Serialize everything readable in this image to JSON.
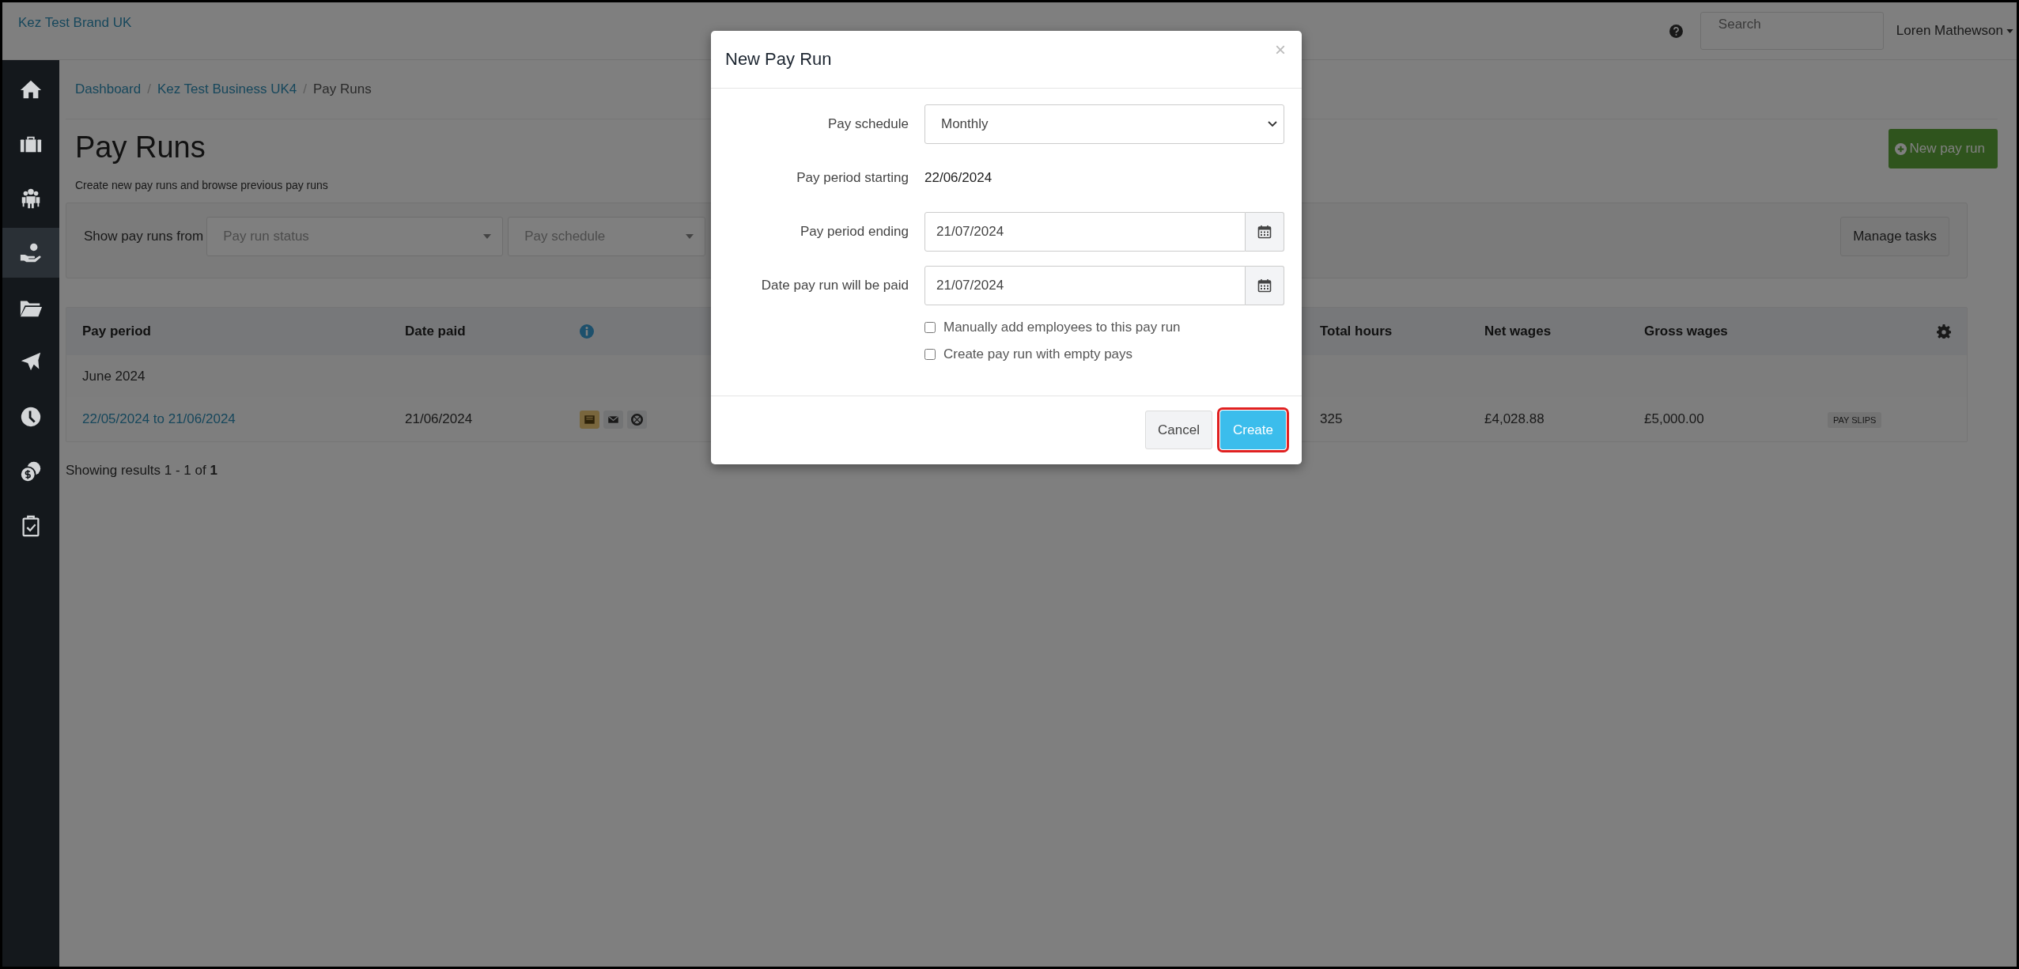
{
  "topbar": {
    "brand": "Kez Test Brand UK",
    "search": {
      "placeholder": "Search"
    },
    "user": "Loren Mathewson"
  },
  "sidebar": {
    "items": [
      {
        "kind": "home",
        "selected": false
      },
      {
        "kind": "briefcase",
        "selected": false
      },
      {
        "kind": "people",
        "selected": false
      },
      {
        "kind": "hand-coin",
        "selected": true
      },
      {
        "kind": "folder",
        "selected": false
      },
      {
        "kind": "plane",
        "selected": false
      },
      {
        "kind": "clock",
        "selected": false
      },
      {
        "kind": "coins",
        "selected": false
      },
      {
        "kind": "clipboard",
        "selected": false
      }
    ]
  },
  "breadcrumb": {
    "separator": "/",
    "items": [
      "Dashboard",
      "Kez Test Business UK4",
      "Pay Runs"
    ]
  },
  "page": {
    "title": "Pay Runs",
    "subtitle": "Create new pay runs and browse previous pay runs",
    "new_button": "New pay run"
  },
  "filters": {
    "label": "Show pay runs from",
    "selects": [
      {
        "placeholder": "Pay run status"
      },
      {
        "placeholder": "Pay schedule"
      }
    ],
    "manage_button": "Manage tasks"
  },
  "table": {
    "columns": [
      "Pay period",
      "Date paid",
      "Total hours",
      "Net wages",
      "Gross wages"
    ],
    "groups": [
      {
        "label": "June 2024",
        "rows": [
          {
            "pay_period": "22/05/2024 to 21/06/2024",
            "date_paid": "21/06/2024",
            "total_hours": "325",
            "net_wages": "£4,028.88",
            "gross_wages": "£5,000.00",
            "tag": "PAY SLIPS"
          }
        ]
      }
    ]
  },
  "footer": "Showing results 1 - 1 of **1**",
  "modal": {
    "title": "New Pay Run",
    "close": "×",
    "fields": [
      {
        "kind": "select",
        "label": "Pay schedule",
        "value": "Monthly"
      },
      {
        "kind": "text",
        "label": "Pay period starting",
        "value": "22/06/2024"
      },
      {
        "kind": "date",
        "label": "Pay period ending",
        "value": "21/07/2024"
      },
      {
        "kind": "date",
        "label": "Date pay run will be paid",
        "value": "21/07/2024"
      }
    ],
    "checkboxes": [
      {
        "label": "Manually add employees to this pay run",
        "checked": false
      },
      {
        "label": "Create pay run with empty pays",
        "checked": false
      }
    ],
    "buttons": [
      {
        "label": "Cancel",
        "kind": "default",
        "highlighted": false
      },
      {
        "label": "Create",
        "kind": "primary",
        "highlighted": true
      }
    ]
  }
}
